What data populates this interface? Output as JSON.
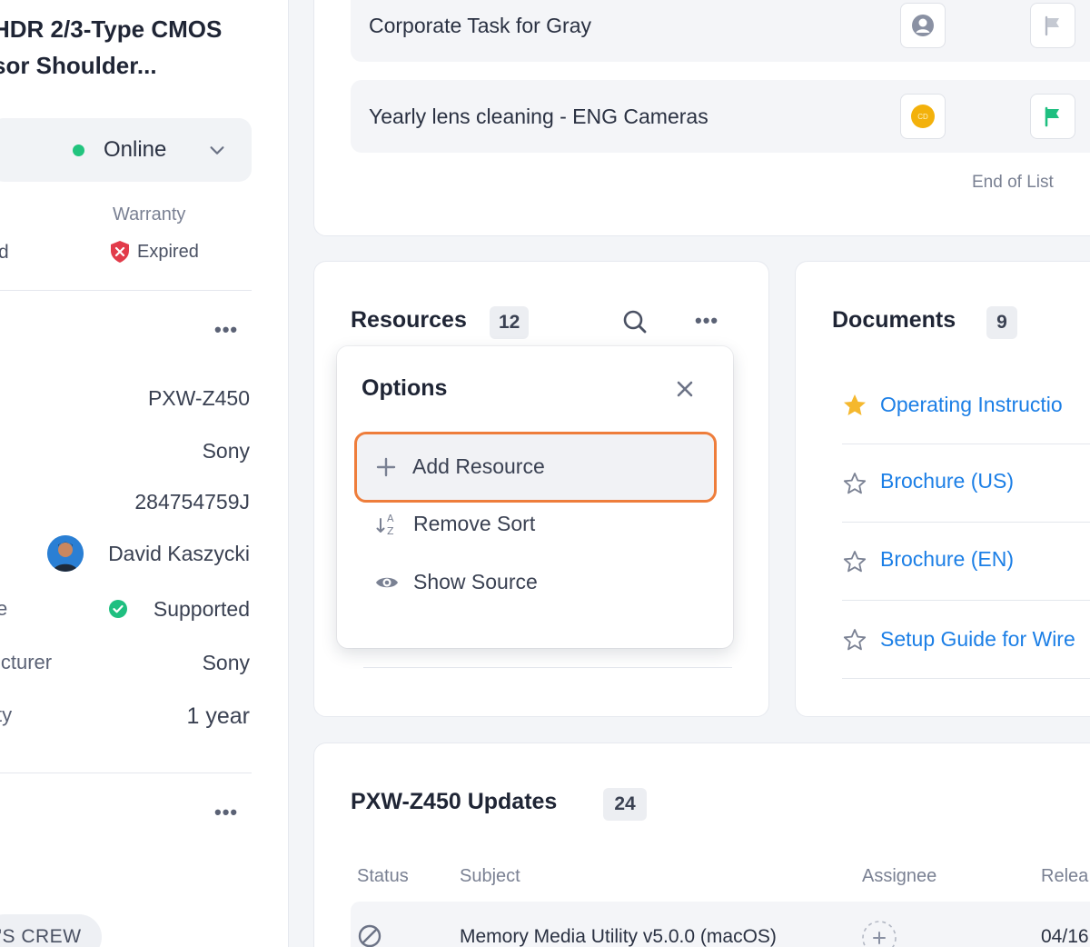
{
  "asset": {
    "title_line1": "HDR 2/3-Type CMOS",
    "title_line2": "sor Shoulder...",
    "status": "Online",
    "warranty_label": "Warranty",
    "warranty_value": "Expired",
    "cut_label_text": "d"
  },
  "details": {
    "model": "PXW-Z450",
    "brand": "Sony",
    "serial": "284754759J",
    "owner": "David Kaszycki",
    "support_label": "e",
    "support_value": "Supported",
    "manufacturer_label": "icturer",
    "manufacturer_value": "Sony",
    "warranty_term_label": "ty",
    "warranty_term_value": "1 year"
  },
  "crew_tag": "'S CREW",
  "tasks": {
    "items": [
      {
        "title": "Corporate Task for Gray"
      },
      {
        "title": "Yearly lens cleaning - ENG Cameras",
        "avatar_initials": "CD"
      }
    ],
    "end_of_list": "End of List"
  },
  "resources": {
    "title": "Resources",
    "count": "12"
  },
  "options_popover": {
    "title": "Options",
    "items": [
      {
        "label": "Add Resource"
      },
      {
        "label": "Remove Sort"
      },
      {
        "label": "Show Source"
      }
    ]
  },
  "documents": {
    "title": "Documents",
    "count": "9",
    "items": [
      {
        "label": "Operating Instructio",
        "starred": true
      },
      {
        "label": "Brochure (US)",
        "starred": false
      },
      {
        "label": "Brochure (EN)",
        "starred": false
      },
      {
        "label": "Setup Guide for Wire",
        "starred": false
      }
    ]
  },
  "updates": {
    "title": "PXW-Z450 Updates",
    "count": "24",
    "columns": [
      "Status",
      "Subject",
      "Assignee",
      "Relea"
    ],
    "rows": [
      {
        "subject": "Memory Media Utility v5.0.0 (macOS)",
        "date": "04/16"
      }
    ]
  },
  "colors": {
    "online": "#22c47e",
    "expired": "#e23b4a",
    "supported": "#1fbf80",
    "link": "#1c7fe6",
    "highlight_outline": "#ee7d3b",
    "flag_green": "#1fbf80",
    "star_gold": "#f5b82e"
  }
}
